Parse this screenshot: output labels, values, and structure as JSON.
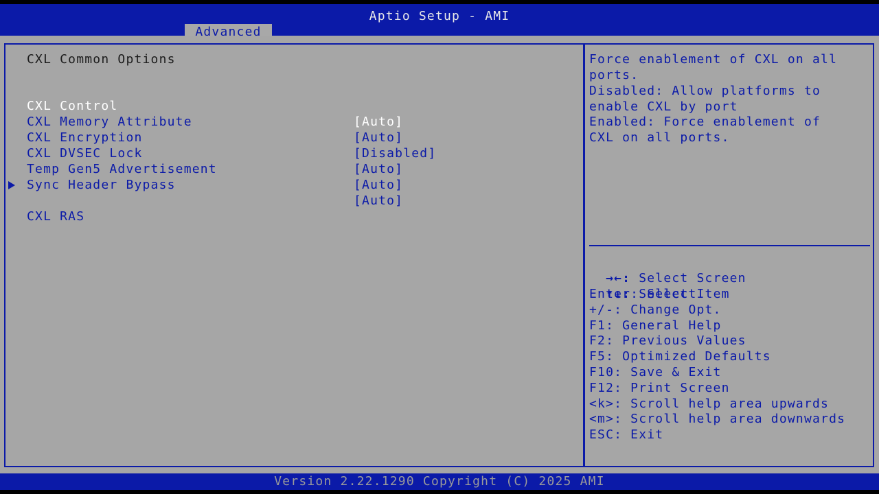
{
  "header": {
    "title": "Aptio Setup - AMI",
    "active_tab": "Advanced"
  },
  "page": {
    "section_title": "CXL Common Options",
    "items": [
      {
        "label": "CXL Control",
        "value": "[Auto]"
      },
      {
        "label": "CXL Memory Attribute",
        "value": "[Auto]"
      },
      {
        "label": "CXL Encryption",
        "value": "[Disabled]"
      },
      {
        "label": "CXL DVSEC Lock",
        "value": "[Auto]"
      },
      {
        "label": "Temp Gen5 Advertisement",
        "value": "[Auto]"
      },
      {
        "label": "Sync Header Bypass",
        "value": "[Auto]"
      }
    ],
    "submenu": {
      "label": "CXL RAS",
      "icon": "right-triangle-icon"
    }
  },
  "help": {
    "lines": [
      "Force enablement of CXL on all",
      "ports.",
      "Disabled: Allow platforms to",
      "enable CXL by port",
      "Enabled: Force enablement of",
      "CXL on all ports."
    ]
  },
  "keys": {
    "select_screen": {
      "key": "→←:",
      "text": " Select Screen"
    },
    "select_item": {
      "key": "↑↓:",
      "text": " Select Item"
    },
    "lines": [
      "Enter: Select",
      "+/-: Change Opt.",
      "F1: General Help",
      "F2: Previous Values",
      "F5: Optimized Defaults",
      "F10: Save & Exit",
      "F12: Print Screen",
      "<k>: Scroll help area upwards",
      "<m>: Scroll help area downwards",
      "ESC: Exit"
    ]
  },
  "footer": {
    "version": "Version 2.22.1290 Copyright (C) 2025 AMI"
  },
  "colors": {
    "bar_blue": "#0b1aa8",
    "panel_gray": "#a6a6a6",
    "selected_text": "#ffffff"
  }
}
